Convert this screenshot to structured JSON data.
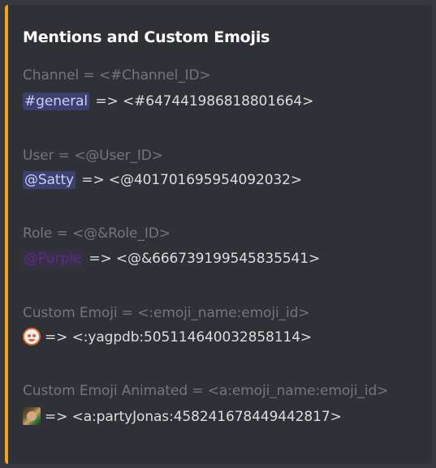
{
  "embed": {
    "accent_color": "#f3a41b",
    "title": "Mentions and Custom Emojis",
    "fields": [
      {
        "label": "Channel = <#Channel_ID>",
        "mention": "#general",
        "value": "=> <#647441986818801664>"
      },
      {
        "label": "User = <@User_ID>",
        "mention": "@Satty",
        "value": "=> <@401701695954092032>"
      },
      {
        "label": "Role = <@&Role_ID>",
        "mention": "@Purple",
        "value": "=> <@&666739199545835541>"
      },
      {
        "label": "Custom Emoji = <:emoji_name:emoji_id>",
        "emoji": "yagpdb-emoji-icon",
        "value": "=> <:yagpdb:505114640032858114>"
      },
      {
        "label": "Custom Emoji Animated = <a:emoji_name:emoji_id>",
        "emoji": "party-jonas-emoji-icon",
        "value": "=> <a:partyJonas:458241678449442817>"
      }
    ]
  }
}
